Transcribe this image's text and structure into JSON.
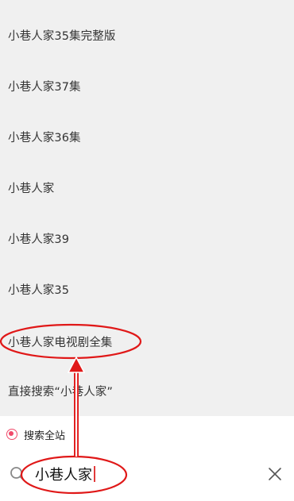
{
  "suggestions": [
    "小巷人家35集完整版",
    "小巷人家37集",
    "小巷人家36集",
    "小巷人家",
    "小巷人家39",
    "小巷人家35",
    "小巷人家电视剧全集",
    "直接搜索“小巷人家”"
  ],
  "search_scope": {
    "label": "搜索全站",
    "selected": true
  },
  "search": {
    "value": "小巷人家"
  },
  "icons": {
    "search": "search-icon",
    "clear": "close-icon",
    "radio": "radio-selected-icon"
  },
  "colors": {
    "suggestion_bg": "#f0f0f0",
    "accent": "#f04a6a",
    "annotation": "#e01818"
  }
}
